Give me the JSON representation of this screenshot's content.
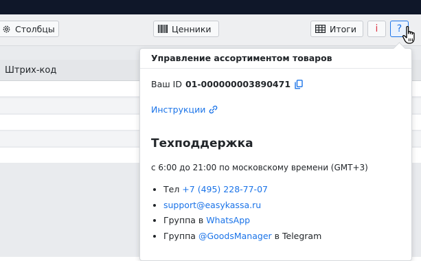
{
  "toolbar": {
    "columns_label": "Столбцы",
    "labels_label": "Ценники",
    "totals_label": "Итоги",
    "info_label": "i",
    "help_label": "?"
  },
  "table": {
    "headers": [
      "Штрих-код"
    ]
  },
  "popover": {
    "title": "Управление ассортиментом товаров",
    "id_prefix": "Ваш ID",
    "id_value": "01-000000003890471",
    "instructions_link": "Инструкции",
    "support_title": "Техподдержка",
    "hours": "с 6:00 до 21:00 по московскому времени (GMT+3)",
    "contacts": [
      {
        "prefix": "Тел ",
        "link": "+7 (495) 228-77-07",
        "suffix": ""
      },
      {
        "prefix": "",
        "link": "support@easykassa.ru",
        "suffix": ""
      },
      {
        "prefix": "Группа в ",
        "link": "WhatsApp",
        "suffix": ""
      },
      {
        "prefix": "Группа ",
        "link": "@GoodsManager",
        "suffix": " в Telegram"
      }
    ]
  },
  "colors": {
    "accent": "#1a73e8",
    "topbar": "#0f1729",
    "danger": "#dc3545"
  }
}
